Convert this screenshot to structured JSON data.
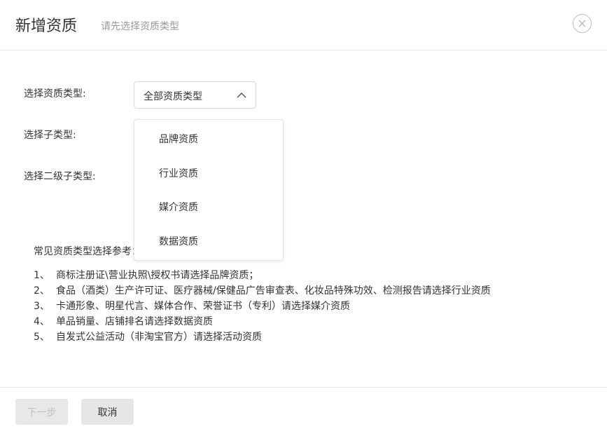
{
  "header": {
    "title": "新增资质",
    "subtitle": "请先选择资质类型",
    "close_icon": "close-circle-icon"
  },
  "form": {
    "type_label": "选择资质类型:",
    "subtype_label": "选择子类型:",
    "second_subtype_label": "选择二级子类型:",
    "select_value": "全部资质类型",
    "select_icon": "chevron-up-icon"
  },
  "dropdown": {
    "items": [
      {
        "label": "品牌资质"
      },
      {
        "label": "行业资质"
      },
      {
        "label": "媒介资质"
      },
      {
        "label": "数据资质"
      }
    ]
  },
  "reference": {
    "title": "常见资质类型选择参考：",
    "items": [
      {
        "num": "1、",
        "text": "商标注册证\\营业执照\\授权书请选择品牌资质；"
      },
      {
        "num": "2、",
        "text": "食品（酒类）生产许可证、医疗器械/保健品广告审查表、化妆品特殊功效、检测报告请选择行业资质"
      },
      {
        "num": "3、",
        "text": "卡通形象、明星代言、媒体合作、荣誉证书（专利）请选择媒介资质"
      },
      {
        "num": "4、",
        "text": "单品销量、店铺排名请选择数据资质"
      },
      {
        "num": "5、",
        "text": "自发式公益活动（非淘宝官方）请选择活动资质"
      }
    ]
  },
  "footer": {
    "next_label": "下一步",
    "cancel_label": "取消"
  },
  "colors": {
    "border": "#e8e8e8",
    "disabled_bg": "#e8e8e8",
    "disabled_text": "#c0c0c0",
    "muted_text": "#999999"
  }
}
